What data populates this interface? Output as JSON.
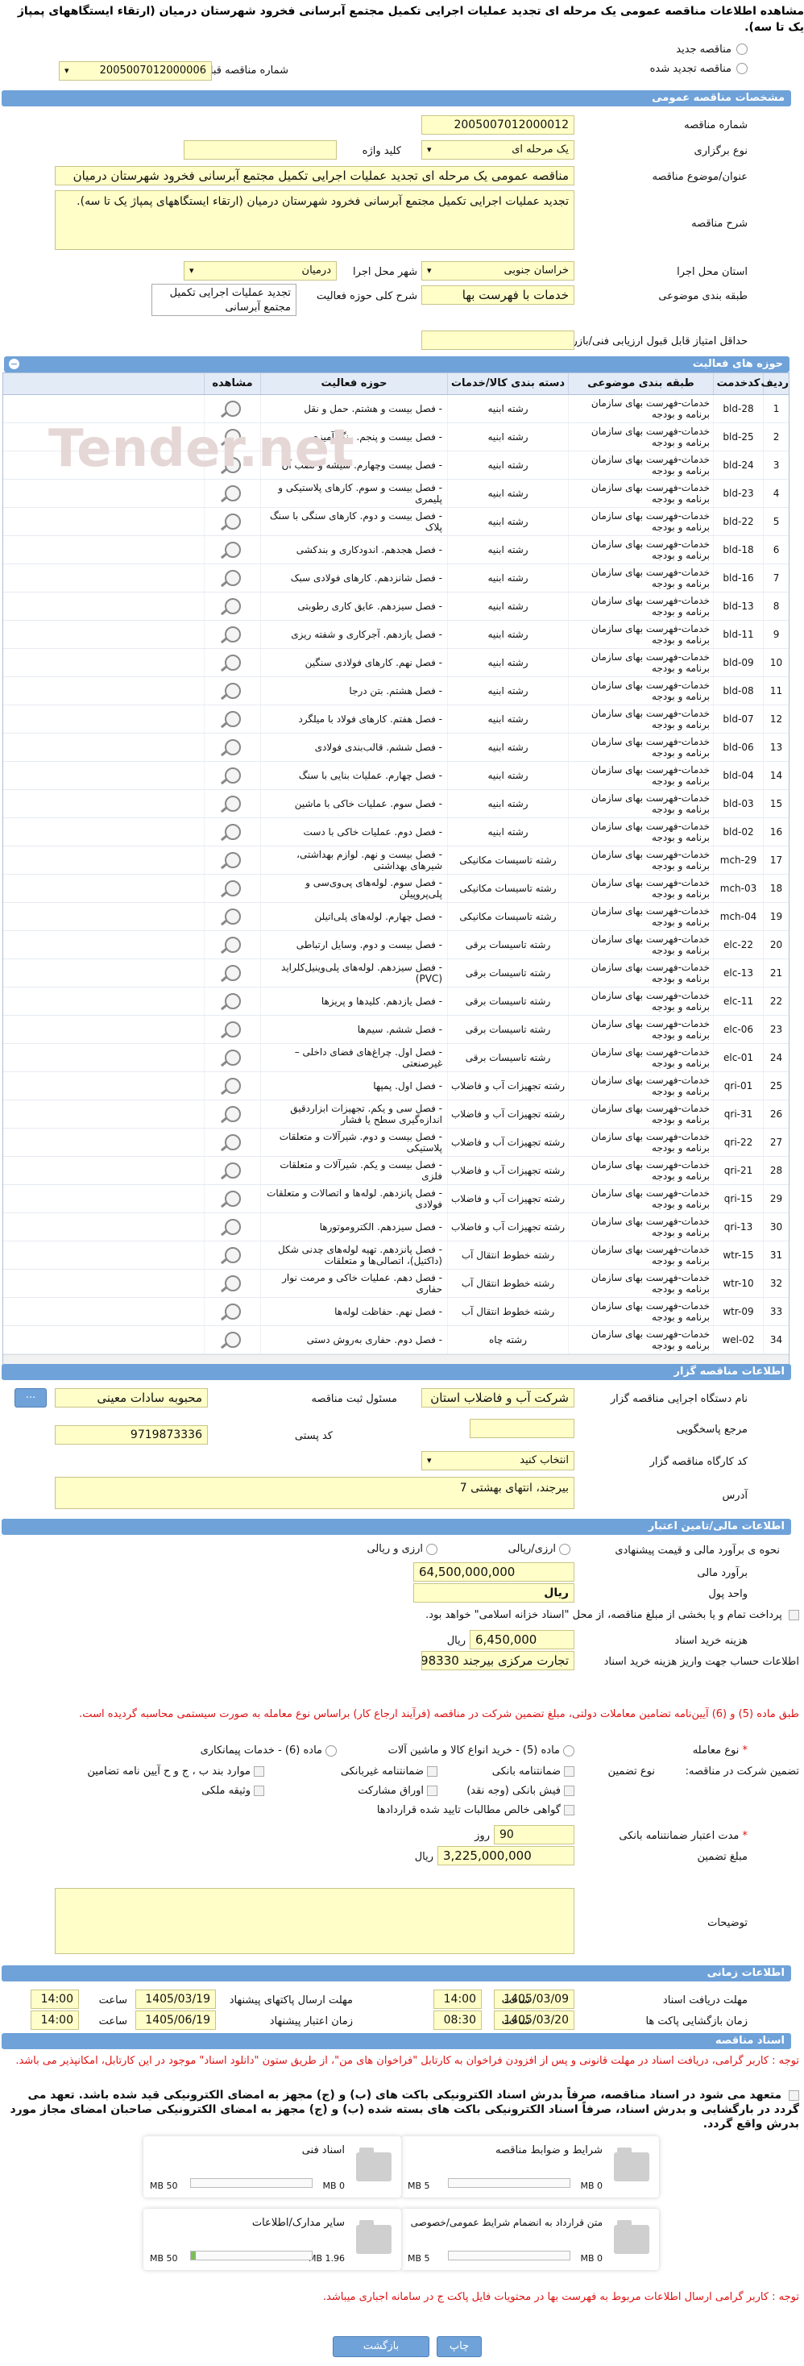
{
  "page": {
    "title": "مشاهده اطلاعات مناقصه عمومی یک مرحله ای تجدید عملیات اجرایی تکمیل مجتمع آبرسانی فخرود شهرستان درمیان (ارتقاء ایستگاههای پمپاژ یک تا سه).",
    "radio_new": "مناقصه جدید",
    "radio_renewed": "مناقصه تجدید شده",
    "prev_tender_label": "شماره مناقصه قبلی",
    "prev_tender_value": "2005007012000006"
  },
  "sections": {
    "specs": "مشخصات مناقصه عمومی",
    "activity": "حوزه های فعالیت",
    "organizer": "اطلاعات مناقصه گزار",
    "finance": "اطلاعات مالی/تامین اعتبار",
    "timing": "اطلاعات زمانی",
    "documents": "اسناد مناقصه"
  },
  "specs": {
    "number_label": "شماره مناقصه",
    "number": "2005007012000012",
    "type_label": "نوع برگزاری",
    "type": "یک مرحله ای",
    "keyword_label": "کلید واژه",
    "keyword": "",
    "subject_label": "عنوان/موضوع مناقصه",
    "subject": "مناقصه عمومی یک مرحله ای تجدید عملیات اجرایی تکمیل مجتمع آبرسانی فخرود شهرستان درمیان",
    "desc_label": "شرح مناقصه",
    "desc": "تجدید عملیات اجرایی تکمیل مجتمع آبرسانی فخرود شهرستان درمیان (ارتقاء ایستگاههای پمپاژ یک تا سه).",
    "province_label": "استان محل اجرا",
    "province": "خراسان جنوبی",
    "city_label": "شهر محل اجرا",
    "city": "درمیان",
    "category_label": "طبقه بندی موضوعی",
    "category": "خدمات با فهرست بها",
    "scope_label": "شرح کلی حوزه فعالیت",
    "scope": "تجدید عملیات اجرایی تکمیل مجتمع آبرسانی",
    "min_score_label": "حداقل امتیاز قابل قبول ارزیابی فنی/بازرگانی",
    "min_score": ""
  },
  "table": {
    "headers": [
      "ردیف",
      "کدخدمت",
      "طبقه بندی موضوعی",
      "دسته بندی کالا/خدمات",
      "حوزه فعالیت",
      "مشاهده"
    ],
    "rows": [
      [
        "1",
        "bld-28",
        "خدمات-فهرست بهای سازمان برنامه و بودجه",
        "رشته ابنیه",
        "- فصل بیست و هشتم. حمل و نقل"
      ],
      [
        "2",
        "bld-25",
        "خدمات-فهرست بهای سازمان برنامه و بودجه",
        "رشته ابنیه",
        "- فصل بیست و پنجم. رنگ آمیزی"
      ],
      [
        "3",
        "bld-24",
        "خدمات-فهرست بهای سازمان برنامه و بودجه",
        "رشته ابنیه",
        "- فصل بیست وچهارم. شیشه و نصب آن"
      ],
      [
        "4",
        "bld-23",
        "خدمات-فهرست بهای سازمان برنامه و بودجه",
        "رشته ابنیه",
        "- فصل بیست و سوم. کارهای پلاستیکی و پلیمری"
      ],
      [
        "5",
        "bld-22",
        "خدمات-فهرست بهای سازمان برنامه و بودجه",
        "رشته ابنیه",
        "- فصل بیست و دوم. کارهای سنگی با سنگ پلاک"
      ],
      [
        "6",
        "bld-18",
        "خدمات-فهرست بهای سازمان برنامه و بودجه",
        "رشته ابنیه",
        "- فصل هجدهم. اندودکاری و بندکشی"
      ],
      [
        "7",
        "bld-16",
        "خدمات-فهرست بهای سازمان برنامه و بودجه",
        "رشته ابنیه",
        "- فصل شانزدهم. کارهای فولادی سبک"
      ],
      [
        "8",
        "bld-13",
        "خدمات-فهرست بهای سازمان برنامه و بودجه",
        "رشته ابنیه",
        "- فصل سیزدهم. عایق کاری رطوبتی"
      ],
      [
        "9",
        "bld-11",
        "خدمات-فهرست بهای سازمان برنامه و بودجه",
        "رشته ابنیه",
        "- فصل یازدهم. آجرکاری و شفته ریزی"
      ],
      [
        "10",
        "bld-09",
        "خدمات-فهرست بهای سازمان برنامه و بودجه",
        "رشته ابنیه",
        "- فصل نهم. کارهای فولادی سنگین"
      ],
      [
        "11",
        "bld-08",
        "خدمات-فهرست بهای سازمان برنامه و بودجه",
        "رشته ابنیه",
        "- فصل هشتم. بتن درجا"
      ],
      [
        "12",
        "bld-07",
        "خدمات-فهرست بهای سازمان برنامه و بودجه",
        "رشته ابنیه",
        "- فصل هفتم. کارهای فولاد با میلگرد"
      ],
      [
        "13",
        "bld-06",
        "خدمات-فهرست بهای سازمان برنامه و بودجه",
        "رشته ابنیه",
        "- فصل ششم. قالب‌بندی فولادی"
      ],
      [
        "14",
        "bld-04",
        "خدمات-فهرست بهای سازمان برنامه و بودجه",
        "رشته ابنیه",
        "- فصل چهارم. عملیات بنایی با سنگ"
      ],
      [
        "15",
        "bld-03",
        "خدمات-فهرست بهای سازمان برنامه و بودجه",
        "رشته ابنیه",
        "- فصل سوم. عملیات خاکی با ماشین"
      ],
      [
        "16",
        "bld-02",
        "خدمات-فهرست بهای سازمان برنامه و بودجه",
        "رشته ابنیه",
        "- فصل دوم. عملیات خاکی با دست"
      ],
      [
        "17",
        "mch-29",
        "خدمات-فهرست بهای سازمان برنامه و بودجه",
        "رشته تاسیسات مکانیکی",
        "- فصل بیست و نهم. لوازم بهداشتی، شیرهای بهداشتی"
      ],
      [
        "18",
        "mch-03",
        "خدمات-فهرست بهای سازمان برنامه و بودجه",
        "رشته تاسیسات مکانیکی",
        "- فصل سوم. لوله‌های پی‌وی‌سی و پلی‌پروپیلن"
      ],
      [
        "19",
        "mch-04",
        "خدمات-فهرست بهای سازمان برنامه و بودجه",
        "رشته تاسیسات مکانیکی",
        "- فصل چهارم. لوله‌های پلی‌اتیلن"
      ],
      [
        "20",
        "elc-22",
        "خدمات-فهرست بهای سازمان برنامه و بودجه",
        "رشته تاسیسات برقی",
        "- فصل بیست و دوم. وسایل ارتباطی"
      ],
      [
        "21",
        "elc-13",
        "خدمات-فهرست بهای سازمان برنامه و بودجه",
        "رشته تاسیسات برقی",
        "- فصل سیزدهم. لوله‌های پلی‌وینیل‌کلراید (PVC)"
      ],
      [
        "22",
        "elc-11",
        "خدمات-فهرست بهای سازمان برنامه و بودجه",
        "رشته تاسیسات برقی",
        "- فصل یازدهم. کلیدها و پریزها"
      ],
      [
        "23",
        "elc-06",
        "خدمات-فهرست بهای سازمان برنامه و بودجه",
        "رشته تاسیسات برقی",
        "- فصل ششم. سیم‌ها"
      ],
      [
        "24",
        "elc-01",
        "خدمات-فهرست بهای سازمان برنامه و بودجه",
        "رشته تاسیسات برقی",
        "- فصل اول. چراغ‌های فضای داخلی – غیرصنعتی"
      ],
      [
        "25",
        "qri-01",
        "خدمات-فهرست بهای سازمان برنامه و بودجه",
        "رشته تجهیزات آب و فاضلاب",
        "- فصل اول. پمپها"
      ],
      [
        "26",
        "qri-31",
        "خدمات-فهرست بهای سازمان برنامه و بودجه",
        "رشته تجهیزات آب و فاضلاب",
        "- فصل سی و یکم. تجهیزات ابزاردقیق اندازه‌گیری سطح یا فشار"
      ],
      [
        "27",
        "qri-22",
        "خدمات-فهرست بهای سازمان برنامه و بودجه",
        "رشته تجهیزات آب و فاضلاب",
        "- فصل بیست و دوم. شیرآلات و متعلقات پلاستیکی"
      ],
      [
        "28",
        "qri-21",
        "خدمات-فهرست بهای سازمان برنامه و بودجه",
        "رشته تجهیزات آب و فاضلاب",
        "- فصل بیست و یکم. شیرآلات و متعلقات فلزی"
      ],
      [
        "29",
        "qri-15",
        "خدمات-فهرست بهای سازمان برنامه و بودجه",
        "رشته تجهیزات آب و فاضلاب",
        "- فصل پانزدهم. لوله‌ها و اتصالات و متعلقات فولادی"
      ],
      [
        "30",
        "qri-13",
        "خدمات-فهرست بهای سازمان برنامه و بودجه",
        "رشته تجهیزات آب و فاضلاب",
        "- فصل سیزدهم. الکتروموتورها"
      ],
      [
        "31",
        "wtr-15",
        "خدمات-فهرست بهای سازمان برنامه و بودجه",
        "رشته خطوط انتقال آب",
        "- فصل پانزدهم. تهیه لوله‌های چدنی شکل (داکتیل)، اتصالی‌ها و متعلقات"
      ],
      [
        "32",
        "wtr-10",
        "خدمات-فهرست بهای سازمان برنامه و بودجه",
        "رشته خطوط انتقال آب",
        "- فصل دهم. عملیات خاکی و مرمت نوار حفاری"
      ],
      [
        "33",
        "wtr-09",
        "خدمات-فهرست بهای سازمان برنامه و بودجه",
        "رشته خطوط انتقال آب",
        "- فصل نهم. حفاظت لوله‌ها"
      ],
      [
        "34",
        "wel-02",
        "خدمات-فهرست بهای سازمان برنامه و بودجه",
        "رشته چاه",
        "- فصل دوم. حفاری به‌روش دستی"
      ]
    ]
  },
  "organizer": {
    "org_label": "نام دستگاه اجرایی مناقصه گزار",
    "org": "شرکت آب و فاضلاب استان",
    "resp_label": "مسئول ثبت مناقصه",
    "resp": "محبوبه سادات معینی",
    "ref_label": "مرجع پاسخگویی",
    "ref": "",
    "postal_label": "کد پستی",
    "postal": "9719873336",
    "workshop_label": "کد کارگاه مناقصه گزار",
    "workshop": "انتخاب کنید",
    "address_label": "آدرس",
    "address": "بیرجند، انتهای بهشتی 7",
    "more_btn": "..."
  },
  "finance": {
    "estimate_label": "نحوه ی برآورد مالی و قیمت پیشنهادی",
    "opt_rial": "ارزی/ریالی",
    "opt_fx": "ارزی و ریالی",
    "budget_label": "برآورد مالی",
    "budget": "64,500,000,000",
    "currency_label": "واحد پول",
    "currency": "ریال",
    "treasury_note": "پرداخت تمام و یا بخشی از مبلغ مناقصه، از محل \"اسناد خزانه اسلامی\" خواهد بود.",
    "doc_cost_label": "هزینه خرید اسناد",
    "doc_cost": "6,450,000",
    "doc_cost_unit": "ریال",
    "account_label": "اطلاعات حساب جهت واریز هزینه خرید اسناد",
    "account": "تجارت مرکزی بیرجند 098330",
    "article_note": "طبق ماده (5) و (6) آیین‌نامه تضامین معاملات دولتی، مبلغ تضمین شرکت در مناقصه (فرآیند ارجاع کار) براساس نوع معامله به صورت سیستمی محاسبه گردیده است.",
    "deal_type_label": "نوع معامله",
    "deal_opt1": "ماده (5) - خرید انواع کالا و ماشین آلات",
    "deal_opt2": "ماده (6) - خدمات پیمانکاری",
    "guarantee_label": "تضمین شرکت در مناقصه:",
    "guarantee_type_label": "نوع تضمین",
    "g1": "ضمانتنامه بانکی",
    "g2": "ضمانتنامه غیربانکی",
    "g3": "موارد بند ب ، ج و ح آیین نامه تضامین",
    "g4": "فیش بانکی (وجه نقد)",
    "g5": "اوراق مشارکت",
    "g6": "وثیقه ملکی",
    "g7": "گواهی خالص مطالبات تایید شده قراردادها",
    "validity_label": "مدت اعتبار ضمانتنامه بانکی",
    "validity": "90",
    "validity_unit": "روز",
    "amount_label": "مبلغ تضمین",
    "amount": "3,225,000,000",
    "amount_unit": "ریال",
    "notes_label": "توضیحات",
    "notes": ""
  },
  "timing": {
    "receive_label": "مهلت دریافت اسناد",
    "receive_date": "1405/03/09",
    "receive_time": "14:00",
    "submit_label": "مهلت ارسال پاکتهای پیشنهاد",
    "submit_date": "1405/03/19",
    "submit_time": "14:00",
    "open_label": "زمان بازگشایی پاکت ها",
    "open_date": "1405/03/20",
    "open_time": "08:30",
    "valid_label": "زمان اعتبار پیشنهاد",
    "valid_date": "1405/06/19",
    "valid_time": "14:00",
    "time_label": "ساعت"
  },
  "documents": {
    "note1": "توجه : کاربر گرامی، دریافت اسناد در مهلت قانونی و پس از افزودن فراخوان به کارتابل \"فراخوان های من\"، از طریق ستون \"دانلود اسناد\" موجود در این کارتابل، امکانپذیر می باشد.",
    "note2": "متعهد می شود در اسناد مناقصه، صرفاً بدرش اسناد الکترونیکی باکت های (ب) و (ج) مجهز به امضای الکترونیکی قید شده باشد. تعهد می گردد در بارگشایی و بدرش اسناد، صرفاً اسناد الکترونیکی باکت های بسته شده (ب) و (ج) مجهز به امضای الکترونیکی صاحبان امضای مجاز مورد بدرش واقع گردد.",
    "boxes": [
      {
        "title": "شرایط و ضوابط مناقصه",
        "min": "0 MB",
        "max": "5 MB"
      },
      {
        "title": "اسناد فنی",
        "min": "0 MB",
        "max": "50 MB"
      },
      {
        "title": "متن قرارداد به انضمام شرایط عمومی/خصوصی",
        "min": "0 MB",
        "max": "5 MB"
      },
      {
        "title": "سایر مدارک/اطلاعات",
        "min": "1.96 MB",
        "max": "50 MB"
      }
    ],
    "note3": "توجه : کاربر گرامی ارسال اطلاعات مربوط به فهرست بها در محتویات فایل پاکت ج در سامانه اجباری میباشد."
  },
  "buttons": {
    "print": "چاپ",
    "back": "بازگشت"
  },
  "watermark": "Tender.net"
}
